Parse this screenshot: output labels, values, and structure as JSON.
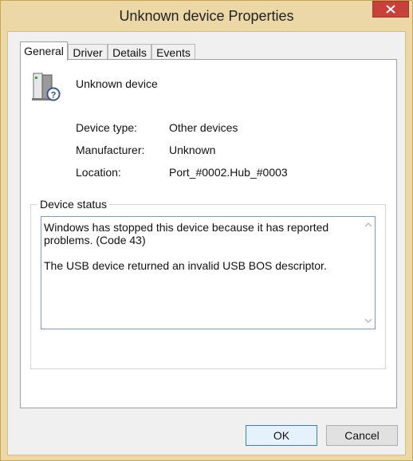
{
  "window": {
    "title": "Unknown device Properties"
  },
  "tabs": [
    {
      "label": "General"
    },
    {
      "label": "Driver"
    },
    {
      "label": "Details"
    },
    {
      "label": "Events"
    }
  ],
  "device": {
    "name": "Unknown device",
    "icon": "unknown-device-icon"
  },
  "properties": [
    {
      "label": "Device type:",
      "value": "Other devices"
    },
    {
      "label": "Manufacturer:",
      "value": "Unknown"
    },
    {
      "label": "Location:",
      "value": "Port_#0002.Hub_#0003"
    }
  ],
  "status": {
    "legend": "Device status",
    "line1": "Windows has stopped this device because it has reported problems. (Code 43)",
    "line2": "The USB device returned an invalid USB BOS descriptor."
  },
  "buttons": {
    "ok": "OK",
    "cancel": "Cancel"
  },
  "colors": {
    "frame": "#ecd7a6",
    "close": "#c7403a",
    "focus_border": "#7a9ad0"
  }
}
